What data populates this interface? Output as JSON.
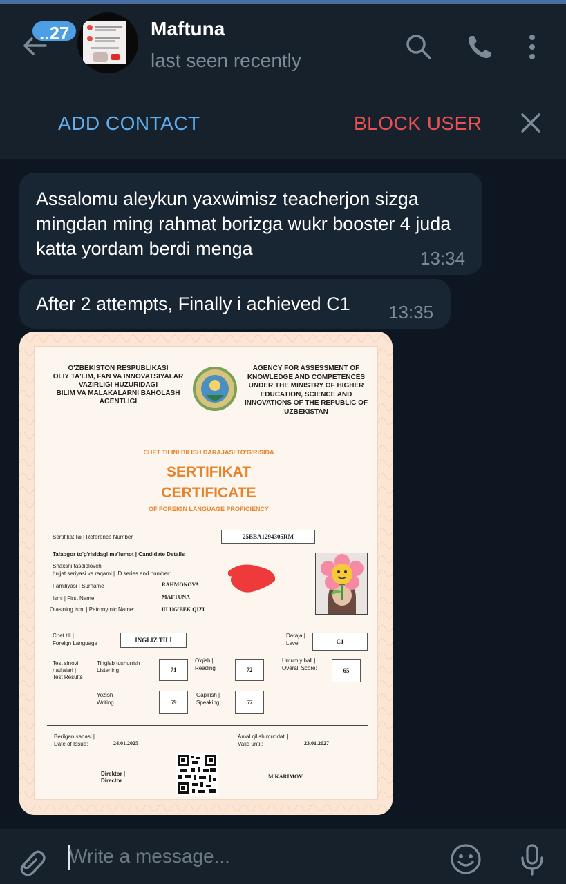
{
  "header": {
    "unread_badge": "..27",
    "contact_name": "Maftuna",
    "status": "last seen recently"
  },
  "actions": {
    "add_contact": "ADD CONTACT",
    "block_user": "BLOCK USER"
  },
  "messages": [
    {
      "text": "Assalomu aleykun yaxwimisz teacherjon sizga mingdan ming rahmat borizga wukr booster 4 juda katta yordam berdi menga",
      "time": "13:34"
    },
    {
      "text": "After 2 attempts, Finally i achieved C1",
      "time": "13:35"
    }
  ],
  "certificate": {
    "left_heading": [
      "O'ZBEKISTON RESPUBLIKASI",
      "OLIY TA'LIM, FAN VA INNOVATSIYALAR",
      "VAZIRLIGI HUZURIDAGI",
      "BILIM VA MALAKALARNI BAHOLASH",
      "AGENTLIGI"
    ],
    "right_heading": [
      "AGENCY FOR ASSESSMENT OF",
      "KNOWLEDGE AND COMPETENCES",
      "UNDER THE MINISTRY OF HIGHER",
      "EDUCATION, SCIENCE AND",
      "INNOVATIONS OF THE REPUBLIC OF",
      "UZBEKISTAN"
    ],
    "subtitle_top": "CHET TILINI BILISH DARAJASI TO'G'RISIDA",
    "title_uz": "SERTIFIKAT",
    "title_en": "CERTIFICATE",
    "subtitle_bottom": "OF FOREIGN LANGUAGE PROFICIENCY",
    "ref_label": "Sertifikat № | Reference Number",
    "ref_number": "25BBA1294305RM",
    "candidate_header": "Talabgor to'g'risidagi ma'lumot | Candidate Details",
    "id_label_1": "Shaxsni tasdiqlovchi",
    "id_label_2": "hujjat seriyasi va raqami | ID series and number:",
    "surname_label": "Familiyasi | Surname",
    "surname": "RAHMONOVA",
    "first_name_label": "Ismi | First Name",
    "first_name": "MAFTUNA",
    "patronymic_label": "Otasining ismi | Patronymic Name:",
    "patronymic": "ULUG'BEK QIZI",
    "language_label_1": "Chet tili |",
    "language_label_2": "Foreign Language",
    "language": "INGLIZ TILI",
    "level_label_1": "Daraja |",
    "level_label_2": "Level",
    "level": "C1",
    "results_label_1": "Test sinovi",
    "results_label_2": "natijalari |",
    "results_label_3": "Test Results",
    "listening_label_1": "Tinglab tushunish |",
    "listening_label_2": "Listening",
    "listening": "71",
    "reading_label_1": "O'qish |",
    "reading_label_2": "Reading",
    "reading": "72",
    "overall_label_1": "Umumiy ball |",
    "overall_label_2": "Overall Score:",
    "overall": "65",
    "writing_label_1": "Yozish |",
    "writing_label_2": "Writing",
    "writing": "59",
    "speaking_label_1": "Gapirish |",
    "speaking_label_2": "Speaking",
    "speaking": "57",
    "issue_label_1": "Berilgan sanasi |",
    "issue_label_2": "Date of Issue:",
    "issue_date": "24.01.2025",
    "valid_label_1": "Amal qilish muddati |",
    "valid_label_2": "Valid until:",
    "valid_date": "23.01.2027",
    "director_label_1": "Direktor |",
    "director_label_2": "Director",
    "director_name": "M.KARIMOV"
  },
  "composer": {
    "placeholder": "Write a message..."
  },
  "colors": {
    "background": "#0e1621",
    "header": "#17212b",
    "bubble": "#182533",
    "accent_blue": "#5eaef0",
    "accent_red": "#ec4f54",
    "muted": "#7d8b99",
    "certificate_orange": "#e8822a"
  },
  "icons": {
    "back": "arrow-left-icon",
    "search": "search-icon",
    "call": "phone-icon",
    "menu": "more-vertical-icon",
    "close": "close-icon",
    "attach": "paperclip-icon",
    "emoji": "smiley-icon",
    "voice": "microphone-icon"
  }
}
